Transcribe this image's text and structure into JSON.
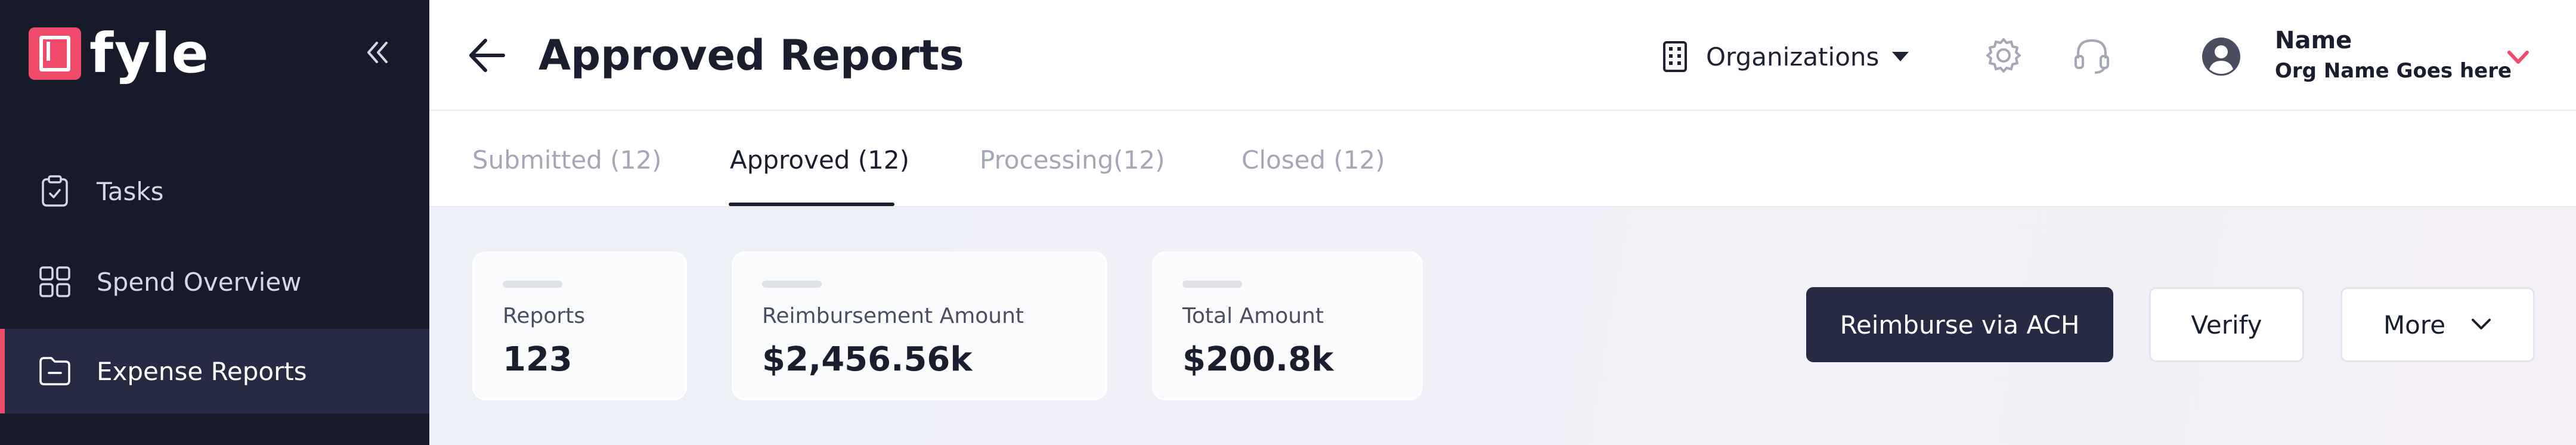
{
  "brand": {
    "name": "fyle",
    "accent_color": "#f04a6a"
  },
  "sidebar": {
    "collapse_icon": "double-chevron-left-icon",
    "items": [
      {
        "label": "Tasks",
        "icon": "clipboard-check-icon",
        "active": false
      },
      {
        "label": "Spend Overview",
        "icon": "grid-icon",
        "active": false
      },
      {
        "label": "Expense Reports",
        "icon": "folder-minus-icon",
        "active": true
      }
    ]
  },
  "header": {
    "title": "Approved Reports",
    "back_icon": "arrow-left-icon",
    "org_selector": {
      "label": "Organizations",
      "icon": "building-icon"
    },
    "settings_icon": "gear-icon",
    "support_icon": "headset-icon",
    "user": {
      "name": "Name",
      "org": "Org Name Goes here",
      "avatar_icon": "user-circle-icon"
    }
  },
  "tabs": [
    {
      "label": "Submitted (12)",
      "active": false
    },
    {
      "label": "Approved (12)",
      "active": true
    },
    {
      "label": "Processing(12)",
      "active": false
    },
    {
      "label": "Closed (12)",
      "active": false
    }
  ],
  "stats": [
    {
      "label": "Reports",
      "value": "123"
    },
    {
      "label": "Reimbursement Amount",
      "value": "$2,456.56k"
    },
    {
      "label": "Total Amount",
      "value": "$200.8k"
    }
  ],
  "actions": {
    "primary_label": "Reimburse via ACH",
    "verify_label": "Verify",
    "more_label": "More"
  },
  "colors": {
    "sidebar_bg": "#161a2b",
    "active_bg": "#262b43",
    "primary_button": "#262b43"
  }
}
